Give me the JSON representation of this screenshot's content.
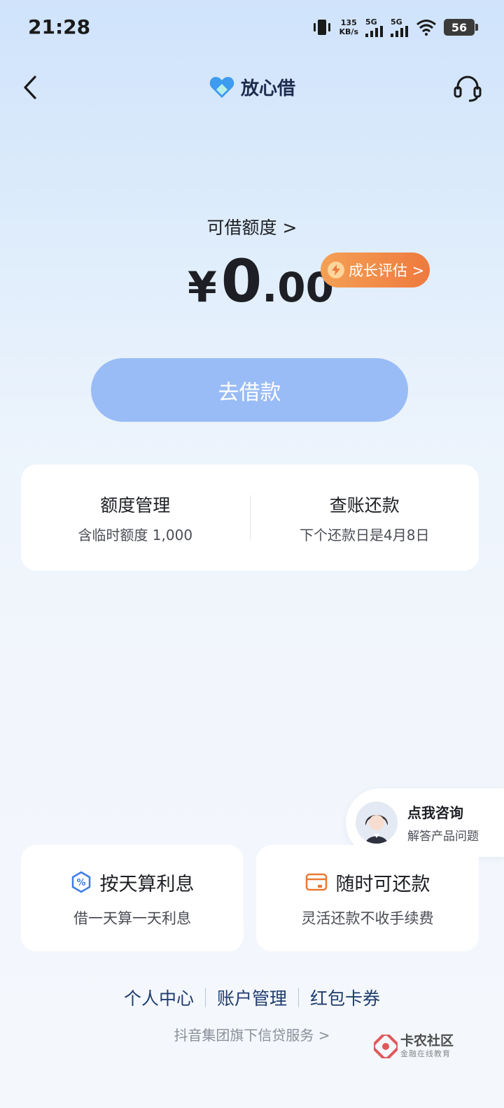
{
  "status_bar": {
    "time": "21:28",
    "net_speed_value": "135",
    "net_speed_unit": "KB/s",
    "signal1": "5G",
    "signal2": "5G",
    "battery": "56"
  },
  "nav": {
    "brand_title": "放心借"
  },
  "limit": {
    "label": "可借额度 >",
    "currency": "¥",
    "integer": "0",
    "decimal": ".00",
    "growth_badge": "成长评估 >"
  },
  "borrow_button": "去借款",
  "card": {
    "left_title": "额度管理",
    "left_sub": "含临时额度 1,000",
    "right_title": "查账还款",
    "right_sub": "下个还款日是4月8日"
  },
  "consult": {
    "title": "点我咨询",
    "sub": "解答产品问题"
  },
  "features": [
    {
      "title": "按天算利息",
      "sub": "借一天算一天利息",
      "icon": "percent-shield-icon"
    },
    {
      "title": "随时可还款",
      "sub": "灵活还款不收手续费",
      "icon": "wallet-icon"
    }
  ],
  "links": [
    "个人中心",
    "账户管理",
    "红包卡券"
  ],
  "footer_note": "抖音集团旗下信贷服务 >",
  "watermark": {
    "title": "卡农社区",
    "sub": "金融在线教育"
  },
  "colors": {
    "accent_blue": "#99bcf6",
    "badge_orange": "#ee7a3e",
    "link": "#1f3d6e"
  }
}
